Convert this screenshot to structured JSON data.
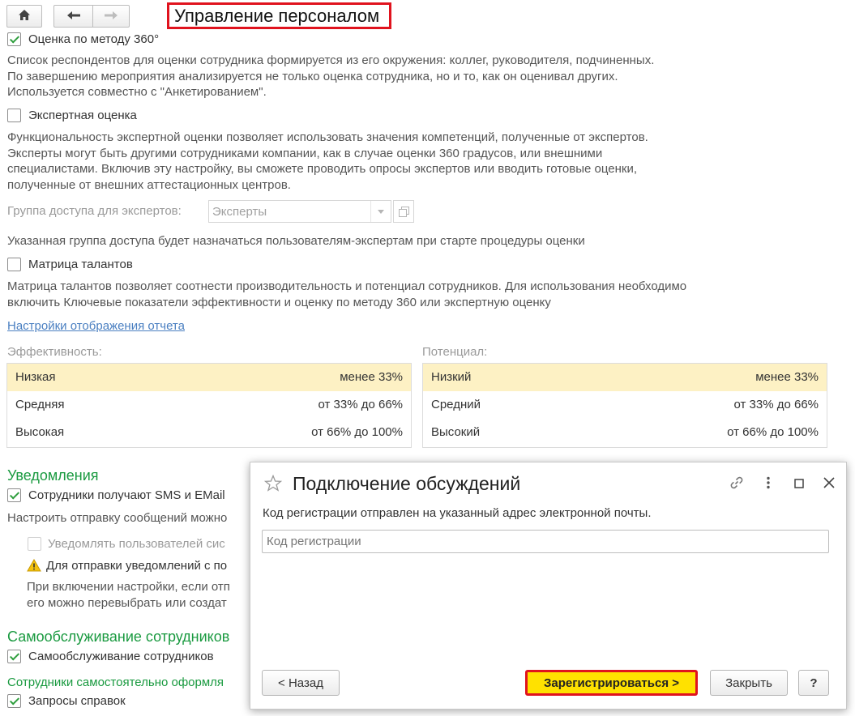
{
  "window": {
    "title": "Управление персоналом"
  },
  "icons": {
    "home": "home-icon",
    "back": "arrow-left-icon",
    "forward": "arrow-right-icon",
    "warning": "warning-icon",
    "star": "star-icon",
    "link": "link-icon",
    "more": "more-vertical-icon",
    "maximize": "maximize-icon",
    "close": "close-icon"
  },
  "colors": {
    "accent_green": "#1a9a40",
    "highlight_border": "#e0131e",
    "primary_button": "#ffe100",
    "selected_row": "#fdf1c4",
    "link": "#4a7fc1"
  },
  "settings": {
    "method360": {
      "label": "Оценка по методу 360°",
      "checked": true,
      "desc": [
        "Список респондентов для оценки сотрудника формируется из его окружения: коллег, руководителя, подчиненных.",
        "По завершению мероприятия анализируется не только оценка сотрудника, но и то, как он оценивал других.",
        "Используется совместно с \"Анкетированием\"."
      ]
    },
    "expert": {
      "label": "Экспертная оценка",
      "checked": false,
      "desc": [
        "Функциональность экспертной оценки позволяет использовать значения компетенций, полученные от экспертов.",
        "Эксперты могут быть другими сотрудниками компании, как в случае оценки 360 градусов, или внешними",
        "специалистами. Включив эту настройку, вы сможете проводить опросы экспертов или вводить готовые оценки,",
        "полученные от внешних аттестационных центров."
      ],
      "group_label": "Группа доступа для экспертов:",
      "group_value": "Эксперты",
      "group_note": "Указанная группа доступа будет назначаться пользователям-экспертам при старте процедуры оценки"
    },
    "talent_matrix": {
      "label": "Матрица талантов",
      "checked": false,
      "desc": [
        "Матрица талантов позволяет соотнести производительность и потенциал сотрудников. Для использования необходимо",
        "включить Ключевые показатели эффективности и оценку по методу 360 или экспертную оценку"
      ],
      "report_link": "Настройки отображения отчета"
    },
    "efficiency": {
      "title": "Эффективность:",
      "rows": [
        {
          "name": "Низкая",
          "value": "менее 33%"
        },
        {
          "name": "Средняя",
          "value": "от 33% до 66%"
        },
        {
          "name": "Высокая",
          "value": "от 66% до 100%"
        }
      ]
    },
    "potential": {
      "title": "Потенциал:",
      "rows": [
        {
          "name": "Низкий",
          "value": "менее 33%"
        },
        {
          "name": "Средний",
          "value": "от 33% до 66%"
        },
        {
          "name": "Высокий",
          "value": "от 66% до 100%"
        }
      ]
    },
    "notifications": {
      "heading": "Уведомления",
      "sms_label": "Сотрудники получают SMS и EMail",
      "sms_checked": true,
      "setup_text": "Настроить отправку сообщений можно",
      "notify_users_label": "Уведомлять пользователей сис",
      "warning_text": "Для отправки уведомлений с по",
      "info_line1": "При включении настройки, если отп",
      "info_line2": "его можно перевыбрать или создат"
    },
    "self_service": {
      "heading": "Самообслуживание сотрудников",
      "label": "Самообслуживание сотрудников",
      "checked": true,
      "info": "Сотрудники самостоятельно оформля",
      "requests_label": "Запросы справок",
      "requests_checked": true
    }
  },
  "dialog": {
    "title": "Подключение обсуждений",
    "message": "Код регистрации отправлен на указанный адрес электронной почты.",
    "code_placeholder": "Код регистрации",
    "code_value": "",
    "back_label": "< Назад",
    "register_label": "Зарегистрироваться >",
    "close_label": "Закрыть",
    "help_label": "?"
  }
}
